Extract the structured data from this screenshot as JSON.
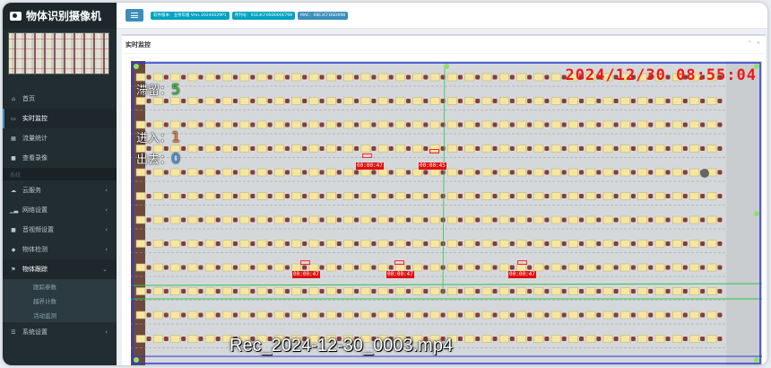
{
  "app": {
    "title": "物体识别摄像机"
  },
  "sidebar": {
    "items": [
      {
        "label": "首页",
        "icon": "home-icon"
      },
      {
        "label": "实时监控",
        "icon": "monitor-icon"
      },
      {
        "label": "流量统计",
        "icon": "calendar-icon"
      },
      {
        "label": "查看录像",
        "icon": "video-icon"
      }
    ],
    "section": "系统",
    "items2": [
      {
        "label": "云服务",
        "icon": "cloud-icon"
      },
      {
        "label": "网络设置",
        "icon": "signal-icon"
      },
      {
        "label": "音视频设置",
        "icon": "camera-icon"
      },
      {
        "label": "物体检测",
        "icon": "tag-icon"
      }
    ],
    "open_item": {
      "label": "物体跟踪",
      "icon": "flag-icon"
    },
    "sub_items": [
      "跟踪参数",
      "越界计数",
      "活动监测"
    ],
    "last_item": {
      "label": "系统设置",
      "icon": "list-icon"
    }
  },
  "topbar": {
    "badges": [
      "软件版本：业余年版 Vms 20240229P1",
      "序列号：01E3CF0SD000E798",
      "MAC：08E3CFDSD098"
    ]
  },
  "panel": {
    "title": "实时监控",
    "tools": "^ ×"
  },
  "video": {
    "timestamp": "2024/12/30 08:55:04",
    "stay_label": "滞留：",
    "stay_value": "5",
    "in_label": "进入：",
    "in_value": "1",
    "out_label": "出去：",
    "out_value": "0",
    "detections": [
      "00:00:47",
      "00:00:45",
      "00:00:47",
      "00:00:47",
      "00:00:47"
    ],
    "filename": "Rec_2024-12-30_0003.mp4"
  },
  "colors": {
    "accent": "#3c8dbc",
    "sidebar": "#222d32",
    "timestamp": "#f01818"
  }
}
